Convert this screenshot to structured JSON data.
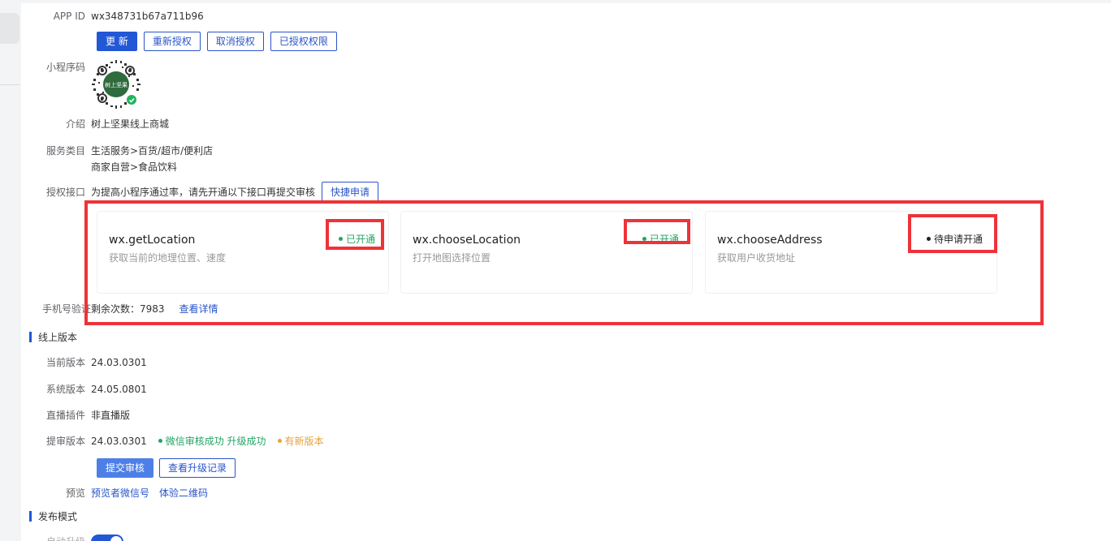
{
  "app": {
    "appid_label": "APP ID",
    "appid_value": "wx348731b67a711b96",
    "buttons": {
      "update": "更 新",
      "reauth": "重新授权",
      "cancel_auth": "取消授权",
      "authorized_perms": "已授权权限"
    },
    "qrcode_label": "小程序码",
    "qrcode_brand": "树上坚果",
    "intro_label": "介绍",
    "intro_value": "树上坚果线上商城",
    "category_label": "服务类目",
    "category_lines": [
      "生活服务>百货/超市/便利店",
      "商家自营>食品饮料"
    ],
    "api_label": "授权接口",
    "api_hint": "为提高小程序通过率，请先开通以下接口再提交审核",
    "quick_apply": "快捷申请",
    "apis": [
      {
        "name": "wx.getLocation",
        "desc": "获取当前的地理位置、速度",
        "status": "已开通"
      },
      {
        "name": "wx.chooseLocation",
        "desc": "打开地图选择位置",
        "status": "已开通"
      },
      {
        "name": "wx.chooseAddress",
        "desc": "获取用户收货地址",
        "status": "待申请开通"
      }
    ],
    "phone_label": "手机号验证",
    "phone_remaining": "剩余次数：7983",
    "phone_detail": "查看详情"
  },
  "online": {
    "section_title": "线上版本",
    "current_label": "当前版本",
    "current_value": "24.03.0301",
    "system_label": "系统版本",
    "system_value": "24.05.0801",
    "live_label": "直播插件",
    "live_value": "非直播版",
    "submit_label": "提审版本",
    "submit_value": "24.03.0301",
    "submit_status": "微信审核成功 升级成功",
    "new_version": "有新版本",
    "submit_review_btn": "提交审核",
    "view_log_btn": "查看升级记录",
    "preview_label": "预览",
    "preview_wechat": "预览者微信号",
    "preview_qr": "体验二维码"
  },
  "publish": {
    "section_title": "发布模式",
    "auto_label": "自动升级",
    "auto_enabled": true
  },
  "colors": {
    "primary": "#2257d6",
    "success": "#22a564",
    "warning": "#e6a23c",
    "highlight": "#ee3338"
  }
}
